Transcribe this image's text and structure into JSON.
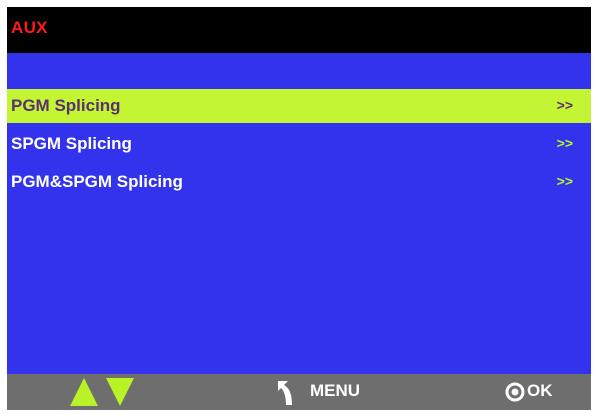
{
  "header": {
    "title": "AUX"
  },
  "menu": {
    "items": [
      {
        "label": "PGM Splicing",
        "arrow": ">>",
        "selected": true
      },
      {
        "label": "SPGM Splicing",
        "arrow": ">>",
        "selected": false
      },
      {
        "label": "PGM&SPGM Splicing",
        "arrow": ">>",
        "selected": false
      }
    ]
  },
  "footer": {
    "nav_icons": [
      "up-arrow-icon",
      "down-arrow-icon"
    ],
    "back_icon": "back-arrow-icon",
    "menu_label": "MENU",
    "ok_icon": "ok-circle-icon",
    "ok_label": "OK"
  },
  "colors": {
    "background": "#3333ee",
    "titlebar": "#000000",
    "title": "#ff1a1a",
    "highlight": "#c4f535",
    "arrow": "#b8f227",
    "footer": "#6e6e6e"
  }
}
